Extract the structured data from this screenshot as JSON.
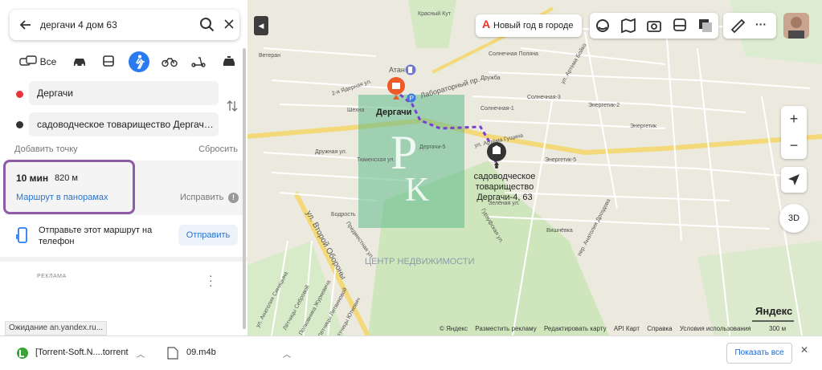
{
  "search": {
    "query": "дергачи 4 дом 63"
  },
  "modes": {
    "all_label": "Все"
  },
  "points": {
    "from": "Дергачи",
    "to": "садоводческое товарищество Дергачи-4, 63"
  },
  "actions": {
    "add_point": "Добавить точку",
    "reset": "Сбросить"
  },
  "route": {
    "time": "10 мин",
    "distance": "820 м",
    "panorama_link": "Маршрут в панорамах",
    "fix_link": "Исправить"
  },
  "send": {
    "text": "Отправьте этот маршрут на телефон",
    "button": "Отправить"
  },
  "ad": {
    "label": "РЕКЛАМА"
  },
  "status": {
    "text": "Ожидание an.yandex.ru..."
  },
  "map": {
    "banner": "Новый год в городе",
    "place_dergachi": "Дергачи",
    "destination_label": "садоводческое товарищество Дергачи-4, 63",
    "atan": "Атан",
    "street_labels": {
      "krasny_kut": "Красный Кут",
      "veteran": "Ветеран",
      "solnechnaya_polyana": "Солнечная Поляна",
      "laboratorny": "Лабораторный пр.",
      "druzhba": "Дружба",
      "enerpetik2": "Энергетик-2",
      "vtoraya_yadernaya": "2-я Ядерная ул.",
      "shekhovskaya": "Шехна",
      "solnechnaya1": "Солнечная-1",
      "solnechnaya3": "Солнечная-3",
      "energetik": "Энергетик",
      "druzhnaya": "Дружная ул.",
      "tyumenskaya": "Тюменская ул.",
      "dergachi5": "Дергачи-5",
      "gushchina": "ул. Артёма Гущина",
      "energetik5": "Энергетик-5",
      "vtoraya_oborona": "ул. Второй Обороны",
      "bodrost": "Бодрость",
      "predmestnaya": "Предместная ул.",
      "gurzufskaya": "Гурзуфская ул.",
      "zelenaya": "Зелёная ул.",
      "vishnevka": "Вишнёвка",
      "drozdova": "пер. Анатолия Дроздова",
      "sinitsyna": "ул. Анатолия Синицына",
      "sebrovoy": "Лётчицы Себровой",
      "zhurkevicha": "Полковника Журкевича",
      "litvinovoy": "Лётчицы Литвиновой",
      "yutkevich": "Лётчицы Юткевич",
      "artema_boyko": "ул. Артема Бойко"
    },
    "watermark": "ЦЕНТР НЕДВИЖИМОСТИ",
    "footer": [
      "© Яндекс",
      "Разместить рекламу",
      "Редактировать карту",
      "API Карт",
      "Справка",
      "Условия использования"
    ],
    "scale": "300 м",
    "brand": "Яндекс",
    "zoom_in": "+",
    "zoom_out": "−",
    "btn_3d": "3D",
    "more": "···"
  },
  "downloads": {
    "items": [
      {
        "name": "[Torrent-Soft.N....torrent"
      },
      {
        "name": "09.m4b"
      }
    ],
    "show_all": "Показать все",
    "close": "✕"
  },
  "colors": {
    "accent": "#2b7bf0",
    "highlight_border": "#8e5ba6",
    "route": "#7b3fd0",
    "poi": "#f05a28"
  }
}
